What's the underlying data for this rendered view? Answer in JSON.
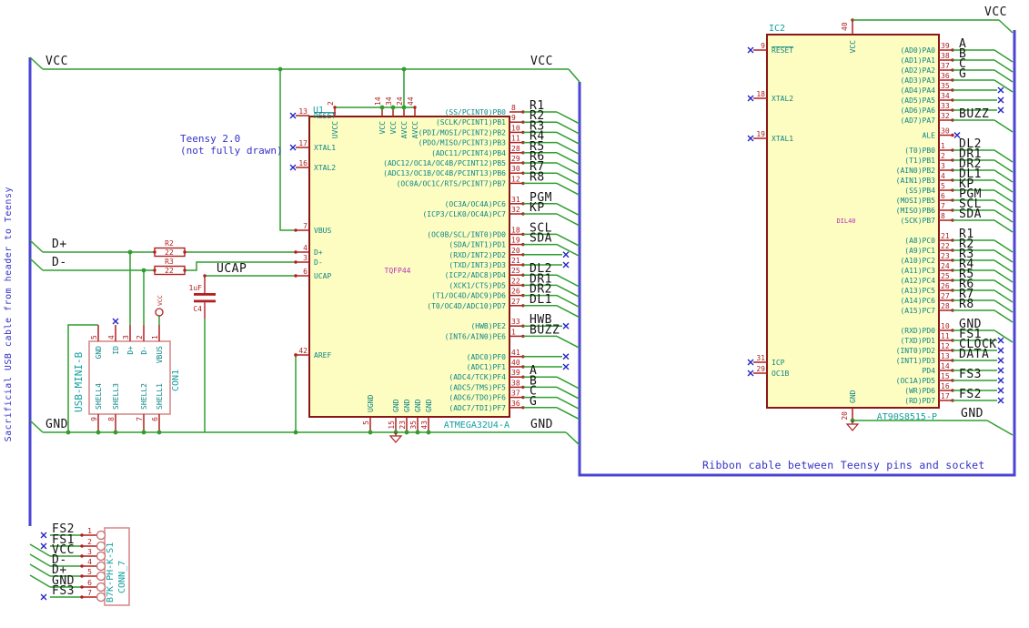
{
  "notes": {
    "side": "Sacrificial USB cable from header to Teensy",
    "teensy1": "Teensy 2.0",
    "teensy2": "(not fully drawn)",
    "ribbon": "Ribbon cable between Teensy pins and socket"
  },
  "rails": {
    "vcc": "VCC",
    "gnd": "GND",
    "dplus": "D+",
    "dminus": "D-",
    "ucap": "UCAP"
  },
  "colors": {
    "wire_green": "#2f9e2f",
    "pin_red": "#b02020",
    "chip_border": "#8b1616",
    "chip_fill": "#fdfcc1",
    "pin_name_teal": "#0c8787",
    "ref_cyan": "#14a0a0",
    "footprint_magenta": "#b833b8",
    "bus_violet": "#4b44d6",
    "noconnect_blue": "#2424c8",
    "note_blue": "#3532c8"
  },
  "u1": {
    "ref": "U1",
    "value": "ATMEGA32U4-A",
    "footprint": "TQFP44",
    "left_pins": [
      {
        "num": "13",
        "name": "RESET",
        "nc": true,
        "overline": true
      },
      {
        "num": "17",
        "name": "XTAL1",
        "nc": true
      },
      {
        "num": "16",
        "name": "XTAL2",
        "nc": true
      },
      {
        "num": "7",
        "name": "VBUS"
      },
      {
        "num": "4",
        "name": "D+"
      },
      {
        "num": "3",
        "name": "D-"
      },
      {
        "num": "6",
        "name": "UCAP"
      },
      {
        "num": "42",
        "name": "AREF"
      }
    ],
    "top_pins": [
      {
        "num": "2",
        "name": "UVCC"
      },
      {
        "num": "14",
        "name": "VCC"
      },
      {
        "num": "34",
        "name": "VCC"
      },
      {
        "num": "24",
        "name": "AVCC"
      },
      {
        "num": "44",
        "name": "AVCC"
      }
    ],
    "bottom_pins": [
      {
        "num": "5",
        "name": "UGND"
      },
      {
        "num": "15",
        "name": "GND"
      },
      {
        "num": "23",
        "name": "GND"
      },
      {
        "num": "35",
        "name": "GND"
      },
      {
        "num": "43",
        "name": "GND"
      }
    ],
    "right_rows": [
      {
        "num": "8",
        "name": "(SS/PCINT0)PB0",
        "label": "R1",
        "bus": true
      },
      {
        "num": "9",
        "name": "(SCLK/PCINT1)PB1",
        "label": "R2",
        "bus": true
      },
      {
        "num": "10",
        "name": "(PDI/MOSI/PCINT2)PB2",
        "label": "R3",
        "bus": true
      },
      {
        "num": "11",
        "name": "(PDO/MISO/PCINT3)PB3",
        "label": "R4",
        "bus": true
      },
      {
        "num": "28",
        "name": "(ADC11/PCINT4)PB4",
        "label": "R5",
        "bus": true
      },
      {
        "num": "29",
        "name": "(ADC12/OC1A/OC4B/PCINT12)PB5",
        "label": "R6",
        "bus": true
      },
      {
        "num": "30",
        "name": "(ADC13/OC1B/OC4B/PCINT13)PB6",
        "label": "R7",
        "bus": true
      },
      {
        "num": "12",
        "name": "(OC0A/OC1C/RTS/PCINT7)PB7",
        "label": "R8",
        "bus": true
      },
      {
        "spacer": 1
      },
      {
        "num": "31",
        "name": "(OC3A/OC4A)PC6",
        "label": "PGM",
        "bus": true
      },
      {
        "num": "32",
        "name": "(ICP3/CLK0/OC4A)PC7",
        "label": "KP",
        "bus": true
      },
      {
        "spacer": 1
      },
      {
        "num": "18",
        "name": "(OC0B/SCL/INT0)PD0",
        "label": "SCL",
        "bus": true
      },
      {
        "num": "19",
        "name": "(SDA/INT1)PD1",
        "label": "SDA",
        "bus": true
      },
      {
        "num": "20",
        "name": "(RXD/INT2)PD2",
        "nc": true
      },
      {
        "num": "21",
        "name": "(TXD/INT3)PD3",
        "nc": true
      },
      {
        "num": "25",
        "name": "(ICP2/ADC8)PD4",
        "label": "DL2",
        "bus": true
      },
      {
        "num": "22",
        "name": "(XCK1/CTS)PD5",
        "label": "DR1",
        "bus": true
      },
      {
        "num": "26",
        "name": "(T1/OC4D/ADC9)PD6",
        "label": "DR2",
        "bus": true
      },
      {
        "num": "27",
        "name": "(T0/OC4D/ADC10)PD7",
        "label": "DL1",
        "bus": true
      },
      {
        "spacer": 1
      },
      {
        "num": "33",
        "name": "(HWB)PE2",
        "label": "HWB",
        "nc": true
      },
      {
        "num": "1",
        "name": "(INT6/AIN0)PE6",
        "label": "BUZZ",
        "bus": true
      },
      {
        "spacer": 1
      },
      {
        "num": "41",
        "name": "(ADC0)PF0",
        "nc": true
      },
      {
        "num": "40",
        "name": "(ADC1)PF1",
        "nc": true
      },
      {
        "num": "39",
        "name": "(ADC4/TCK)PF4",
        "label": "A",
        "bus": true
      },
      {
        "num": "38",
        "name": "(ADC5/TMS)PF5",
        "label": "B",
        "bus": true
      },
      {
        "num": "37",
        "name": "(ADC6/TDO)PF6",
        "label": "C",
        "bus": true
      },
      {
        "num": "36",
        "name": "(ADC7/TDI)PF7",
        "label": "G",
        "bus": true
      }
    ]
  },
  "ic2": {
    "ref": "IC2",
    "value": "AT90S8515-P",
    "footprint": "DIL40",
    "top_pin": {
      "num": "40",
      "name": "VCC"
    },
    "bottom_pin": {
      "num": "20",
      "name": "GND"
    },
    "left_pins": [
      {
        "num": "9",
        "name": "RESET",
        "nc": true,
        "overline": true
      },
      {
        "num": "18",
        "name": "XTAL2",
        "nc": true
      },
      {
        "num": "19",
        "name": "XTAL1",
        "nc": true
      },
      {
        "num": "31",
        "name": "ICP",
        "nc": true
      },
      {
        "num": "29",
        "name": "OC1B",
        "nc": true
      }
    ],
    "right_rows": [
      {
        "num": "39",
        "name": "(AD0)PA0",
        "label": "A",
        "bus": true
      },
      {
        "num": "38",
        "name": "(AD1)PA1",
        "label": "B",
        "bus": true
      },
      {
        "num": "37",
        "name": "(AD2)PA2",
        "label": "C",
        "bus": true
      },
      {
        "num": "36",
        "name": "(AD3)PA3",
        "label": "G",
        "bus": true
      },
      {
        "num": "35",
        "name": "(AD4)PA4",
        "nc": true
      },
      {
        "num": "34",
        "name": "(AD5)PA5",
        "nc": true
      },
      {
        "num": "33",
        "name": "(AD6)PA6",
        "nc": true
      },
      {
        "num": "32",
        "name": "(AD7)PA7",
        "label": "BUZZ",
        "bus": true
      },
      {
        "spacer": 0.5
      },
      {
        "num": "30",
        "name": "ALE",
        "ncpin": true
      },
      {
        "spacer": 0.5
      },
      {
        "num": "1",
        "name": "(T0)PB0",
        "label": "DL2",
        "bus": true
      },
      {
        "num": "2",
        "name": "(T1)PB1",
        "label": "DR1",
        "bus": true
      },
      {
        "num": "3",
        "name": "(AIN0)PB2",
        "label": "DR2",
        "bus": true
      },
      {
        "num": "4",
        "name": "(AIN1)PB3",
        "label": "DL1",
        "bus": true
      },
      {
        "num": "5",
        "name": "(SS)PB4",
        "label": "KP",
        "bus": true
      },
      {
        "num": "6",
        "name": "(MOSI)PB5",
        "label": "PGM",
        "bus": true
      },
      {
        "num": "7",
        "name": "(MISO)PB6",
        "label": "SCL",
        "bus": true
      },
      {
        "num": "8",
        "name": "(SCK)PB7",
        "label": "SDA",
        "bus": true
      },
      {
        "spacer": 1
      },
      {
        "num": "21",
        "name": "(A8)PC0",
        "label": "R1",
        "bus": true
      },
      {
        "num": "22",
        "name": "(A9)PC1",
        "label": "R2",
        "bus": true
      },
      {
        "num": "23",
        "name": "(A10)PC2",
        "label": "R3",
        "bus": true
      },
      {
        "num": "24",
        "name": "(A11)PC3",
        "label": "R4",
        "bus": true
      },
      {
        "num": "25",
        "name": "(A12)PC4",
        "label": "R5",
        "bus": true
      },
      {
        "num": "26",
        "name": "(A13)PC5",
        "label": "R6",
        "bus": true
      },
      {
        "num": "27",
        "name": "(A14)PC6",
        "label": "R7",
        "bus": true
      },
      {
        "num": "28",
        "name": "(A15)PC7",
        "label": "R8",
        "bus": true
      },
      {
        "spacer": 1
      },
      {
        "num": "10",
        "name": "(RXD)PD0",
        "label": "GND",
        "bus": true
      },
      {
        "num": "11",
        "name": "(TXD)PD1",
        "label": "FS1",
        "nc": true
      },
      {
        "num": "12",
        "name": "(INT0)PD2",
        "label": "CLOCK",
        "nc": true
      },
      {
        "num": "13",
        "name": "(INT1)PD3",
        "label": "DATA",
        "nc": true
      },
      {
        "num": "14",
        "name": "PD4",
        "nc": true
      },
      {
        "num": "15",
        "name": "(OC1A)PD5",
        "label": "FS3",
        "nc": true
      },
      {
        "num": "16",
        "name": "(WR)PD6",
        "nc": true
      },
      {
        "num": "17",
        "name": "(RD)PD7",
        "label": "FS2",
        "nc": true
      }
    ]
  },
  "con1": {
    "ref": "CON1",
    "value": "USB-MINI-B",
    "top_pins": [
      {
        "num": "5",
        "name": "GND"
      },
      {
        "num": "4",
        "name": "ID",
        "nc": true
      },
      {
        "num": "3",
        "name": "D+"
      },
      {
        "num": "2",
        "name": "D-"
      },
      {
        "num": "1",
        "name": "VBUS",
        "power": "VCC"
      }
    ],
    "bottom_pins": [
      {
        "num": "9",
        "name": "SHELL4"
      },
      {
        "num": "8",
        "name": "SHELL3"
      },
      {
        "num": "7",
        "name": "SHELL2"
      },
      {
        "num": "6",
        "name": "SHELL1"
      }
    ]
  },
  "conn7": {
    "ref": "CONN_7",
    "value": "B7K-PH-K-S1",
    "pins": [
      {
        "num": "1",
        "label": "FS2",
        "nc": true
      },
      {
        "num": "2",
        "label": "FS1",
        "nc": true
      },
      {
        "num": "3",
        "label": "VCC"
      },
      {
        "num": "4",
        "label": "D-"
      },
      {
        "num": "5",
        "label": "D+"
      },
      {
        "num": "6",
        "label": "GND"
      },
      {
        "num": "7",
        "label": "FS3",
        "nc": true
      }
    ]
  },
  "r2": {
    "ref": "R2",
    "value": "22"
  },
  "r3": {
    "ref": "R3",
    "value": "22"
  },
  "c4": {
    "ref": "C4",
    "value": "1uF"
  }
}
